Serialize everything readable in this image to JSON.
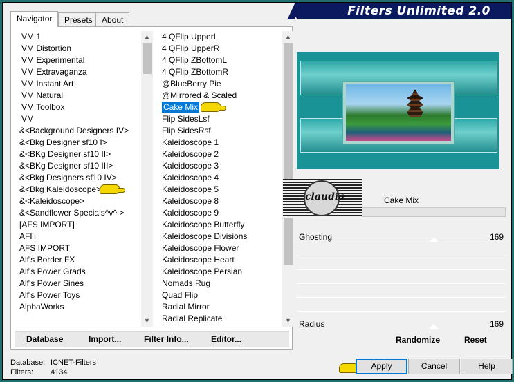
{
  "window_title": "Filters Unlimited 2.0",
  "tabs": [
    "Navigator",
    "Presets",
    "About"
  ],
  "left_list": [
    "VM 1",
    "VM Distortion",
    "VM Experimental",
    "VM Extravaganza",
    "VM Instant Art",
    "VM Natural",
    "VM Toolbox",
    "VM",
    "&<Background Designers IV>",
    "&<Bkg Designer sf10 I>",
    "&<BKg Designer sf10 II>",
    "&<BKg Designer sf10 III>",
    "&<Bkg Designers sf10 IV>",
    "&<Bkg Kaleidoscope>",
    "&<Kaleidoscope>",
    "&<Sandflower Specials^v^ >",
    "[AFS IMPORT]",
    "AFH",
    "AFS IMPORT",
    "Alf's Border FX",
    "Alf's Power Grads",
    "Alf's Power Sines",
    "Alf's Power Toys",
    "AlphaWorks"
  ],
  "mid_list": [
    "4 QFlip UpperL",
    "4 QFlip UpperR",
    "4 QFlip ZBottomL",
    "4 QFlip ZBottomR",
    "@BlueBerry Pie",
    "@Mirrored & Scaled",
    "Cake Mix",
    "Flip SidesLsf",
    "Flip SidesRsf",
    "Kaleidoscope 1",
    "Kaleidoscope 2",
    "Kaleidoscope 3",
    "Kaleidoscope 4",
    "Kaleidoscope 5",
    "Kaleidoscope 8",
    "Kaleidoscope 9",
    "Kaleidoscope Butterfly",
    "Kaleidoscope Divisions",
    "Kaleidoscope Flower",
    "Kaleidoscope Heart",
    "Kaleidoscope Persian",
    "Nomads Rug",
    "Quad Flip",
    "Radial Mirror",
    "Radial Replicate"
  ],
  "selected_filter": "Cake Mix",
  "panel_buttons": {
    "database": "Database",
    "import": "Import...",
    "filter_info": "Filter Info...",
    "editor": "Editor..."
  },
  "logo_text": "claudia",
  "filter_name": "Cake Mix",
  "sliders": [
    {
      "label": "Ghosting",
      "value": "169"
    },
    {
      "label": "Radius",
      "value": "169"
    }
  ],
  "randomize": "Randomize",
  "reset": "Reset",
  "status": {
    "database_label": "Database:",
    "database_value": "ICNET-Filters",
    "filters_label": "Filters:",
    "filters_value": "4134"
  },
  "buttons": {
    "apply": "Apply",
    "cancel": "Cancel",
    "help": "Help"
  },
  "colors": {
    "selection": "#0078d7",
    "title_bar": "#0b1a5e",
    "frame": "#1e7070"
  }
}
